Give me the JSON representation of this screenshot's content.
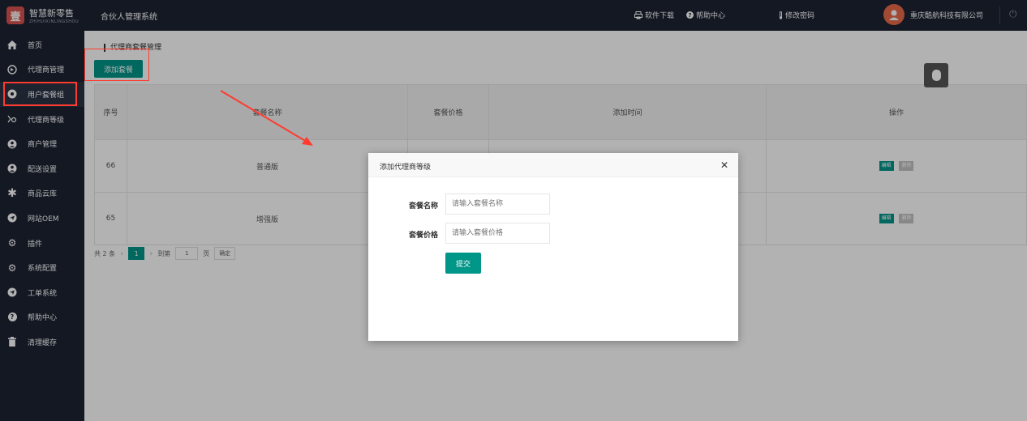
{
  "header": {
    "logo_char": "壹",
    "logo_name": "智慧新零售",
    "logo_pinyin": "ZHIHUIXINLINGSHOU",
    "system_title": "合伙人管理系统",
    "download_label": "软件下载",
    "help_label": "帮助中心",
    "password_label": "修改密码",
    "company": "重庆酷航科技有限公司"
  },
  "sidebar": {
    "items": [
      {
        "label": "首页",
        "icon": "home-icon"
      },
      {
        "label": "代理商管理",
        "icon": "agent-icon"
      },
      {
        "label": "用户套餐组",
        "icon": "package-icon"
      },
      {
        "label": "代理商等级",
        "icon": "level-icon"
      },
      {
        "label": "商户管理",
        "icon": "merchant-icon"
      },
      {
        "label": "配送设置",
        "icon": "delivery-icon"
      },
      {
        "label": "商品云库",
        "icon": "cloud-icon"
      },
      {
        "label": "网站OEM",
        "icon": "oem-icon"
      },
      {
        "label": "插件",
        "icon": "plugin-icon"
      },
      {
        "label": "系统配置",
        "icon": "settings-icon"
      },
      {
        "label": "工单系统",
        "icon": "ticket-icon"
      },
      {
        "label": "帮助中心",
        "icon": "help-icon"
      },
      {
        "label": "清理缓存",
        "icon": "trash-icon"
      }
    ]
  },
  "main": {
    "breadcrumb": "代理商套餐管理",
    "add_button": "添加套餐",
    "table": {
      "headers": [
        "序号",
        "套餐名称",
        "套餐价格",
        "添加时间",
        "操作"
      ],
      "rows": [
        {
          "id": "66",
          "name": "普通版",
          "price": "",
          "time": ""
        },
        {
          "id": "65",
          "name": "增强版",
          "price": "",
          "time": ""
        }
      ],
      "edit_label": "编辑",
      "delete_label": "删除"
    },
    "pager": {
      "total": "共 2 条",
      "current": "1",
      "goto_label": "到第",
      "page_input": "1",
      "page_unit": "页",
      "confirm": "确定"
    }
  },
  "modal": {
    "title": "添加代理商等级",
    "name_label": "套餐名称",
    "name_placeholder": "请输入套餐名称",
    "price_label": "套餐价格",
    "price_placeholder": "请输入套餐价格",
    "submit": "提交"
  },
  "colors": {
    "primary": "#009688",
    "sidebar_bg": "#1c2333",
    "annotation": "#ff3b30"
  }
}
